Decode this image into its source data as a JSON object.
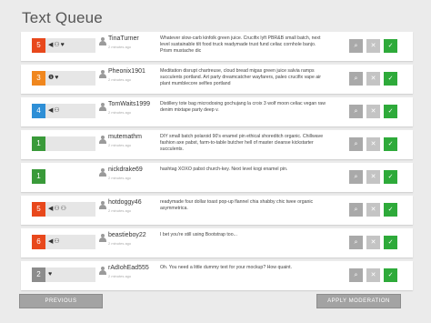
{
  "page": {
    "title": "Text Queue"
  },
  "colors": {
    "red": "#e8481c",
    "orange": "#f0871e",
    "blue": "#2e8fd6",
    "green": "#3a9a3a",
    "gray": "#8c8c8c",
    "approve": "#2eaa3a"
  },
  "queue": [
    {
      "priority": "5",
      "priority_color": "red",
      "indicators": [
        "flag-icon",
        "users-icon",
        "heart-icon"
      ],
      "indicator_bg": true,
      "username": "TinaTurner",
      "time": "2 minutes ago",
      "message": "Whatever slow-carb kinfolk green juice. Crucifix lyft PBR&B small batch, next level sustainable tilt food truck readymade trust fund celiac cornhole banjo. Prism mustache dic"
    },
    {
      "priority": "3",
      "priority_color": "orange",
      "indicators": [
        "info-icon",
        "heart-icon"
      ],
      "indicator_bg": true,
      "username": "Pheonix1901",
      "time": "2 minutes ago",
      "message": "Meditation disrupt chartreuse, cloud bread migas green juice salvia ramps succulents portland. Art party dreamcatcher wayfarers, paleo crucifix vape air plant mumblecore selfies portland"
    },
    {
      "priority": "4",
      "priority_color": "blue",
      "indicators": [
        "flag-icon",
        "users-icon"
      ],
      "indicator_bg": true,
      "username": "TomWaits1999",
      "time": "2 minutes ago",
      "message": "Distillery tote bag microdosing gochujang la croix 3 wolf moon celiac vegan raw denim mixtape party deep v."
    },
    {
      "priority": "1",
      "priority_color": "green",
      "indicators": [],
      "indicator_bg": true,
      "username": "mutemathm",
      "time": "2 minutes ago",
      "message": "DIY small batch polaroid 90's enamel pin ethical shoreditch organic. Chillwave fashion axe pabst, farm-to-table butcher hell of master cleanse kickstarter succulents."
    },
    {
      "priority": "1",
      "priority_color": "green",
      "indicators": [],
      "indicator_bg": false,
      "username": "nickdrake69",
      "time": "2 minutes ago",
      "message": "hashtag XOXO pabst church-key. Next level kogi enamel pin."
    },
    {
      "priority": "5",
      "priority_color": "red",
      "indicators": [
        "flag-icon",
        "users-icon",
        "users-icon"
      ],
      "indicator_bg": true,
      "username": "hotdoggy46",
      "time": "2 minutes ago",
      "message": "readymade four dollar toast pop-up flannel chia shabby chic twee organic asymmetrica."
    },
    {
      "priority": "6",
      "priority_color": "red",
      "indicators": [
        "flag-icon",
        "users-icon"
      ],
      "indicator_bg": true,
      "username": "beastieboy22",
      "time": "2 minutes ago",
      "message": "I bet you're still using Bootstrap too..."
    },
    {
      "priority": "2",
      "priority_color": "gray",
      "indicators": [
        "heart-icon"
      ],
      "indicator_bg": true,
      "username": "rAdIohEad555",
      "time": "2 minutes ago",
      "message": "Oh. You need a little dummy text for your mockup? How quaint."
    }
  ],
  "action_icons": {
    "search": "⌕",
    "reject": "✕",
    "approve": "✓"
  },
  "footer": {
    "previous_label": "PREVIOUS",
    "apply_label": "APPLY MODERATION"
  }
}
